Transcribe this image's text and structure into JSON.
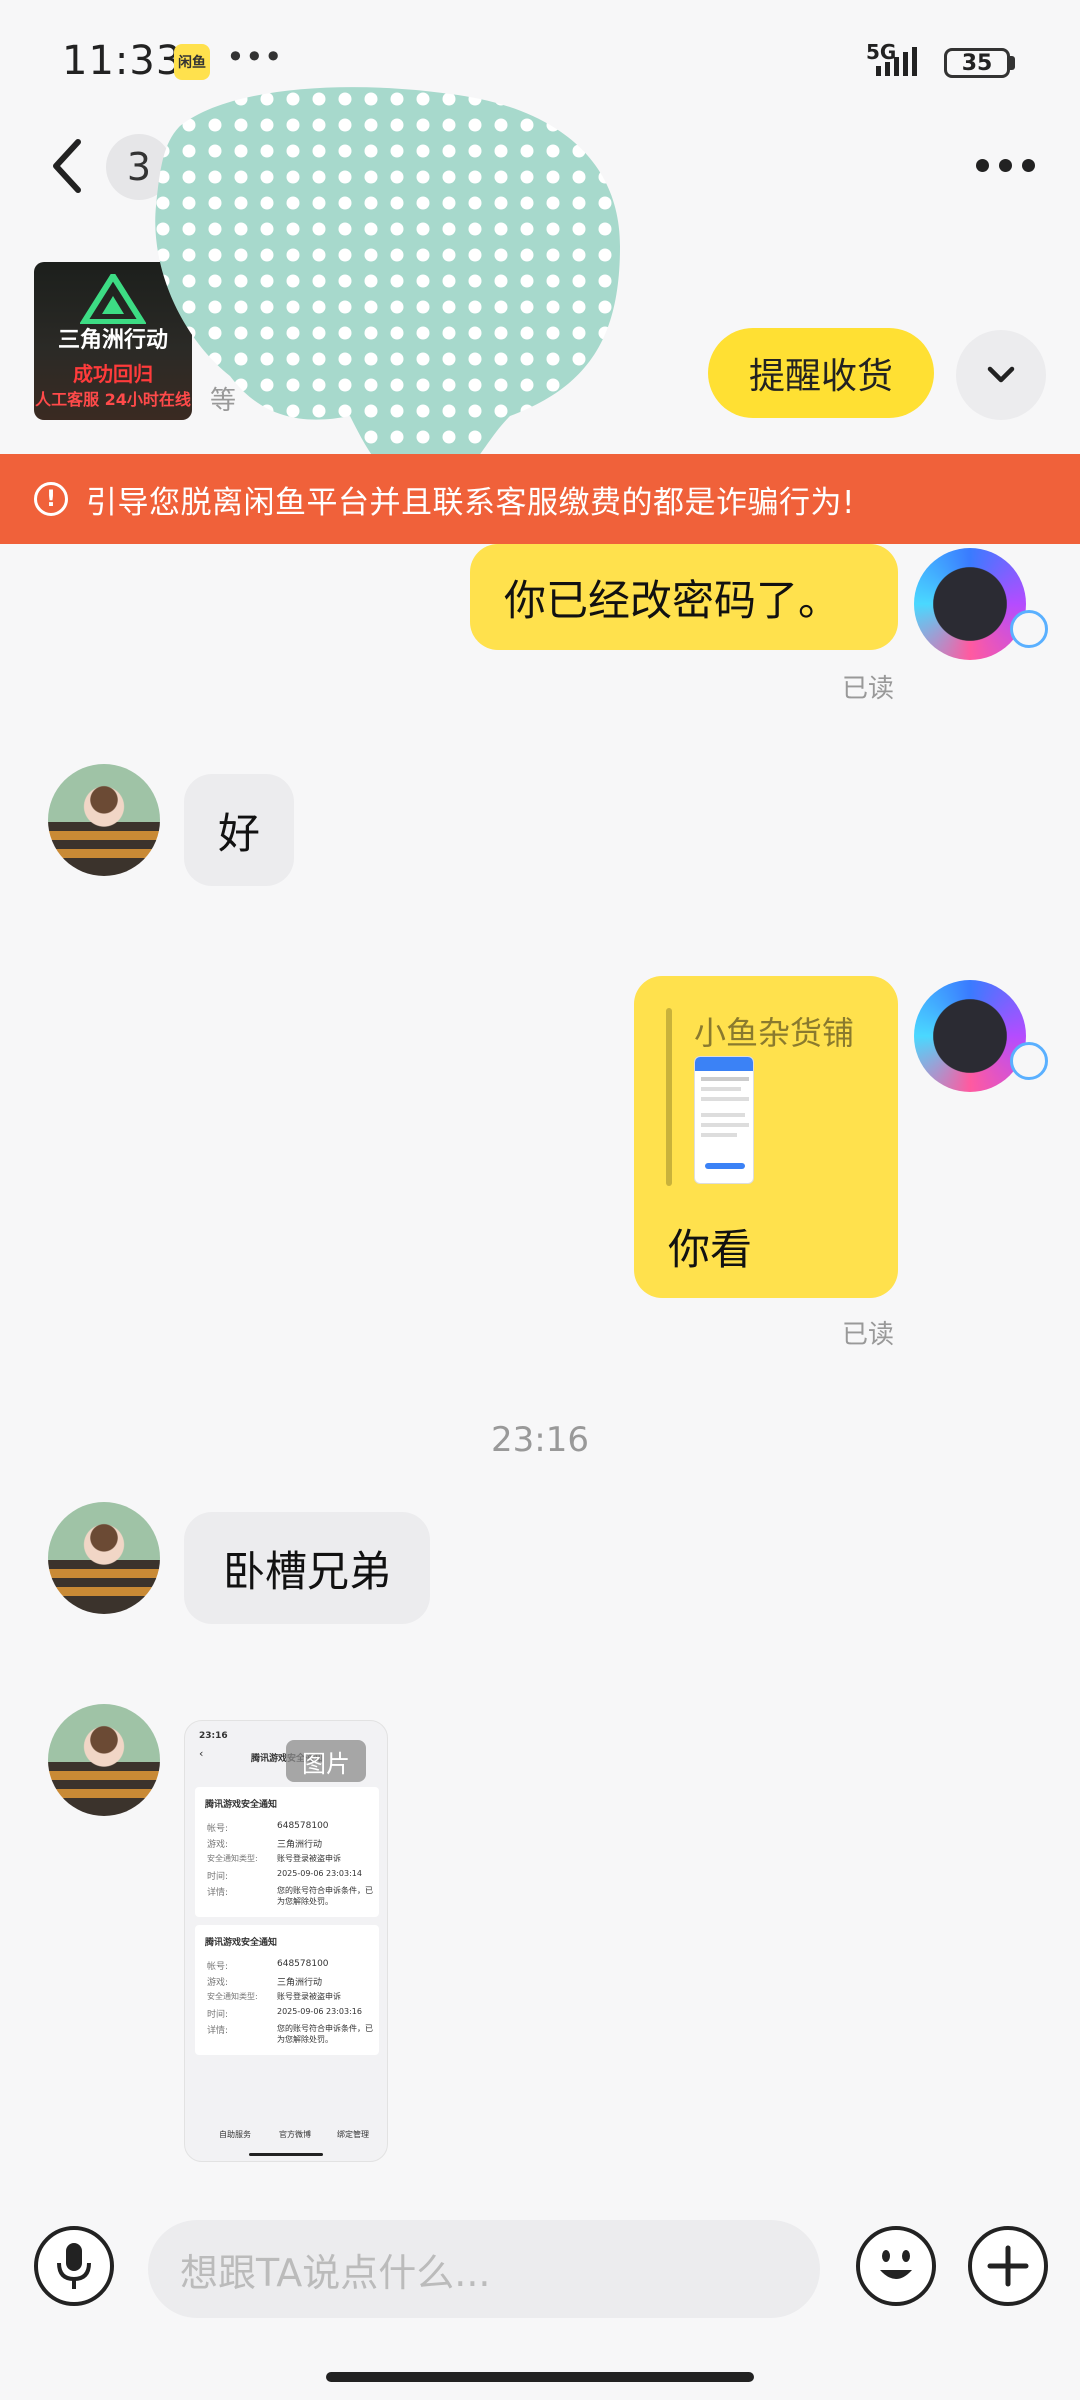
{
  "status_bar": {
    "time": "11:33",
    "app_icon_label": "闲鱼",
    "more": "•••",
    "network": "5G",
    "battery": "35"
  },
  "header": {
    "unread_count": "3"
  },
  "product": {
    "thumb_title": "三角洲行动",
    "thumb_line1": "成功回归",
    "thumb_line2": "人工客服 24小时在线",
    "sub_text": "等",
    "remind_button": "提醒收货"
  },
  "warning": {
    "icon": "!",
    "text": "引导您脱离闲鱼平台并且联系客服缴费的都是诈骗行为!"
  },
  "messages": [
    {
      "side": "self",
      "text": "你已经改密码了。",
      "read": "已读"
    },
    {
      "side": "other",
      "text": "好"
    },
    {
      "side": "self",
      "type": "quote",
      "quote_title": "小鱼杂货铺",
      "text": "你看",
      "read": "已读"
    },
    {
      "type": "time",
      "text": "23:16"
    },
    {
      "side": "other",
      "text": "卧槽兄弟"
    },
    {
      "side": "other",
      "type": "image",
      "tag": "图片",
      "screenshot": {
        "time": "23:16",
        "title": "腾讯游戏安全通知",
        "cards": [
          {
            "heading": "腾讯游戏安全通知",
            "rows": [
              [
                "帐号:",
                "648578100"
              ],
              [
                "游戏:",
                "三角洲行动"
              ],
              [
                "安全通知类型:",
                "账号登录被盗申诉"
              ],
              [
                "时间:",
                "2025-09-06 23:03:14"
              ],
              [
                "详情:",
                "您的账号符合申诉条件，已为您解除处罚。"
              ]
            ]
          },
          {
            "heading": "腾讯游戏安全通知",
            "rows": [
              [
                "帐号:",
                "648578100"
              ],
              [
                "游戏:",
                "三角洲行动"
              ],
              [
                "安全通知类型:",
                "账号登录被盗申诉"
              ],
              [
                "时间:",
                "2025-09-06 23:03:16"
              ],
              [
                "详情:",
                "您的账号符合申诉条件，已为您解除处罚。"
              ]
            ]
          }
        ],
        "footer": [
          "自助服务",
          "官方微博",
          "绑定管理"
        ]
      }
    }
  ],
  "input": {
    "placeholder": "想跟TA说点什么..."
  },
  "colors": {
    "accent_yellow": "#ffe14d",
    "warning_orange": "#f0613a",
    "bubble_gray": "#ececee"
  }
}
